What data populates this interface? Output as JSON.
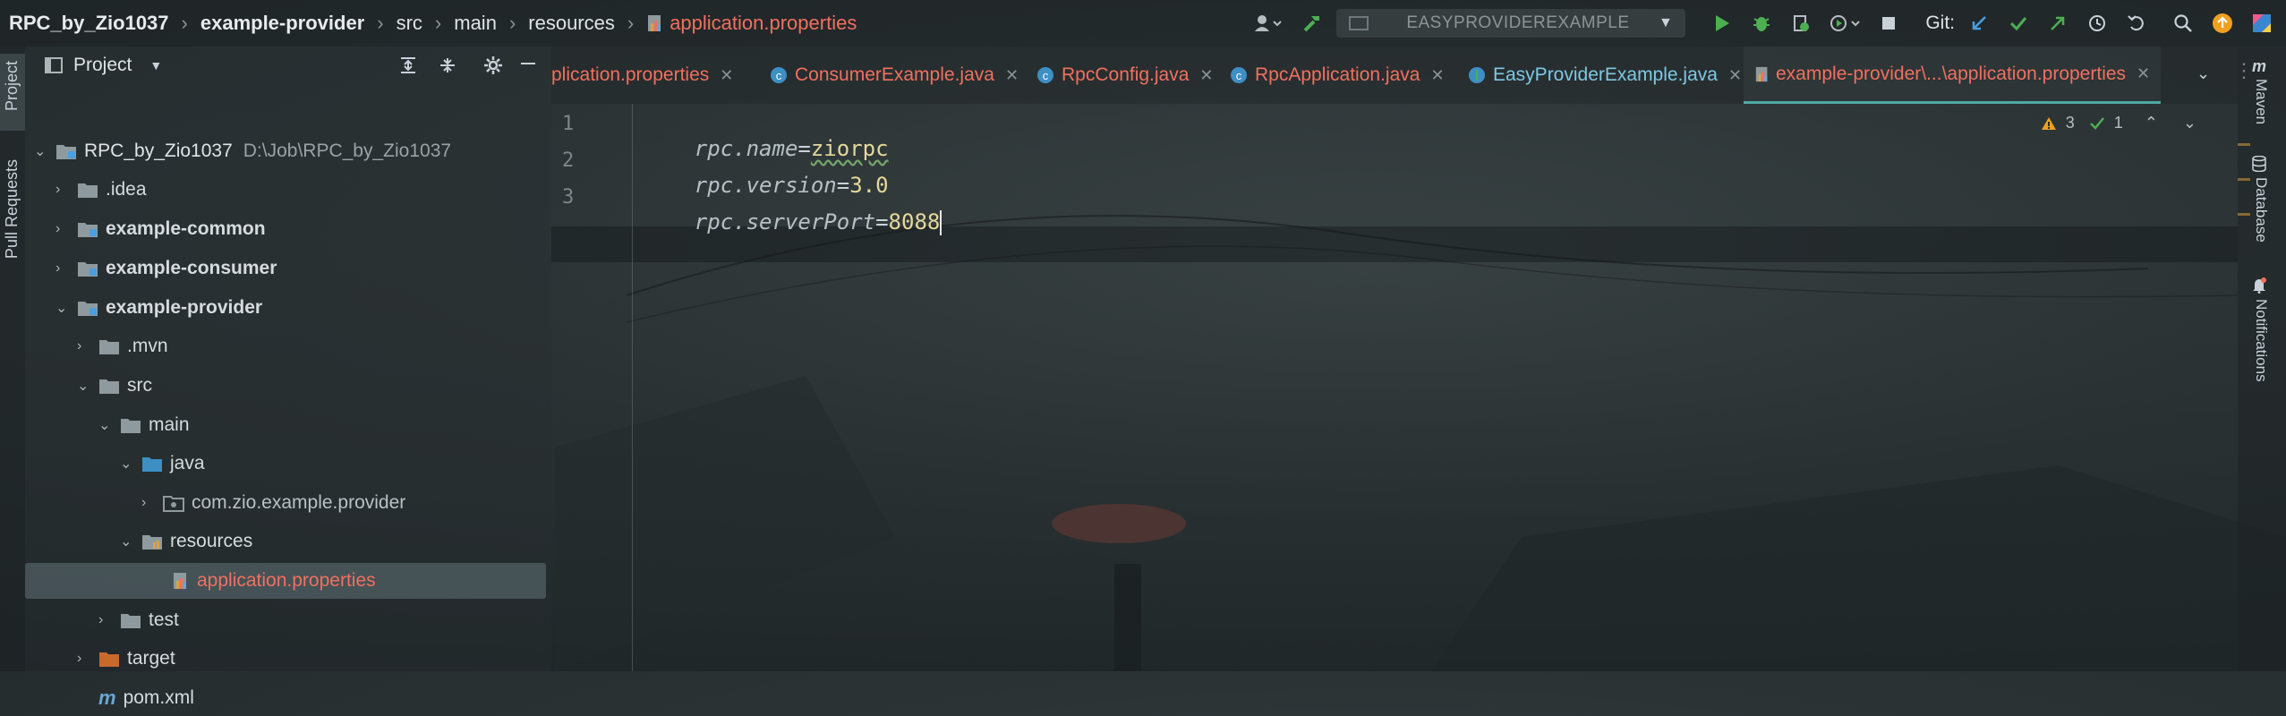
{
  "topbar": {
    "project": "RPC_by_Zio1037",
    "module": "example-provider",
    "path": [
      "src",
      "main",
      "resources"
    ],
    "file": "application.properties",
    "run_config": "EASYPROVIDEREXAMPLE",
    "git_label": "Git:"
  },
  "left_stripe": {
    "project_label": "Project",
    "pull_requests_label": "Pull Requests"
  },
  "project_panel": {
    "title": "Project",
    "root": {
      "name": "RPC_by_Zio1037",
      "path": "D:\\Job\\RPC_by_Zio1037"
    },
    "items": [
      {
        "label": ".idea"
      },
      {
        "label": "example-common"
      },
      {
        "label": "example-consumer"
      },
      {
        "label": "example-provider"
      },
      {
        "label": ".mvn"
      },
      {
        "label": "src"
      },
      {
        "label": "main"
      },
      {
        "label": "java"
      },
      {
        "label": "com.zio.example.provider"
      },
      {
        "label": "resources"
      },
      {
        "label": "application.properties"
      },
      {
        "label": "test"
      },
      {
        "label": "target"
      },
      {
        "label": "pom.xml"
      }
    ]
  },
  "editor": {
    "tabs": [
      {
        "label": "plication.properties"
      },
      {
        "label": "ConsumerExample.java"
      },
      {
        "label": "RpcConfig.java"
      },
      {
        "label": "RpcApplication.java"
      },
      {
        "label": "EasyProviderExample.java"
      },
      {
        "label": "example-provider\\...\\application.properties"
      }
    ],
    "lines": [
      {
        "num": "1",
        "key": "rpc.name",
        "eq": "=",
        "value": "ziorpc"
      },
      {
        "num": "2",
        "key": "rpc.version",
        "eq": "=",
        "value": "3.0"
      },
      {
        "num": "3",
        "key": "rpc.serverPort",
        "eq": "=",
        "value": "8088"
      }
    ],
    "inspections": {
      "warnings": "3",
      "ok": "1"
    }
  },
  "right_stripe": {
    "maven": "Maven",
    "database": "Database",
    "notifications": "Notifications"
  },
  "colors": {
    "accent_file": "#f0705f",
    "value": "#e5d89b",
    "run_green": "#4caf50",
    "folder": "#8f9a9e"
  }
}
